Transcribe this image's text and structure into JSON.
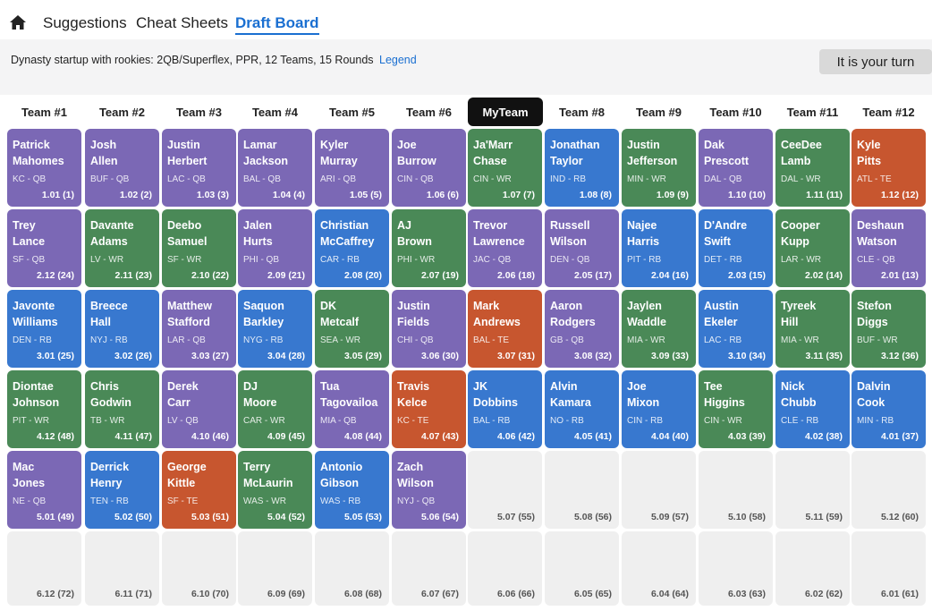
{
  "nav": {
    "tabs": [
      {
        "label": "Suggestions"
      },
      {
        "label": "Cheat Sheets"
      },
      {
        "label": "Draft Board"
      }
    ]
  },
  "header": {
    "description": "Dynasty startup with rookies: 2QB/Superflex, PPR, 12 Teams, 15 Rounds",
    "legend_link": "Legend",
    "turn_button": "It is your turn"
  },
  "colors": {
    "QB": "#7b68b5",
    "RB": "#3878cf",
    "WR": "#4a8957",
    "TE": "#c7562f",
    "active_tab": "#1a6fd1"
  },
  "teams": [
    "Team #1",
    "Team #2",
    "Team #3",
    "Team #4",
    "Team #5",
    "Team #6",
    "MyTeam",
    "Team #8",
    "Team #9",
    "Team #10",
    "Team #11",
    "Team #12"
  ],
  "rounds": [
    [
      {
        "first": "Patrick",
        "last": "Mahomes",
        "meta": "KC - QB",
        "pick": "1.01 (1)",
        "pos": "QB"
      },
      {
        "first": "Josh",
        "last": "Allen",
        "meta": "BUF - QB",
        "pick": "1.02 (2)",
        "pos": "QB"
      },
      {
        "first": "Justin",
        "last": "Herbert",
        "meta": "LAC - QB",
        "pick": "1.03 (3)",
        "pos": "QB"
      },
      {
        "first": "Lamar",
        "last": "Jackson",
        "meta": "BAL - QB",
        "pick": "1.04 (4)",
        "pos": "QB"
      },
      {
        "first": "Kyler",
        "last": "Murray",
        "meta": "ARI - QB",
        "pick": "1.05 (5)",
        "pos": "QB"
      },
      {
        "first": "Joe",
        "last": "Burrow",
        "meta": "CIN - QB",
        "pick": "1.06 (6)",
        "pos": "QB"
      },
      {
        "first": "Ja'Marr",
        "last": "Chase",
        "meta": "CIN - WR",
        "pick": "1.07 (7)",
        "pos": "WR"
      },
      {
        "first": "Jonathan",
        "last": "Taylor",
        "meta": "IND - RB",
        "pick": "1.08 (8)",
        "pos": "RB"
      },
      {
        "first": "Justin",
        "last": "Jefferson",
        "meta": "MIN - WR",
        "pick": "1.09 (9)",
        "pos": "WR"
      },
      {
        "first": "Dak",
        "last": "Prescott",
        "meta": "DAL - QB",
        "pick": "1.10 (10)",
        "pos": "QB"
      },
      {
        "first": "CeeDee",
        "last": "Lamb",
        "meta": "DAL - WR",
        "pick": "1.11 (11)",
        "pos": "WR"
      },
      {
        "first": "Kyle",
        "last": "Pitts",
        "meta": "ATL - TE",
        "pick": "1.12 (12)",
        "pos": "TE"
      }
    ],
    [
      {
        "first": "Trey",
        "last": "Lance",
        "meta": "SF - QB",
        "pick": "2.12 (24)",
        "pos": "QB"
      },
      {
        "first": "Davante",
        "last": "Adams",
        "meta": "LV - WR",
        "pick": "2.11 (23)",
        "pos": "WR"
      },
      {
        "first": "Deebo",
        "last": "Samuel",
        "meta": "SF - WR",
        "pick": "2.10 (22)",
        "pos": "WR"
      },
      {
        "first": "Jalen",
        "last": "Hurts",
        "meta": "PHI - QB",
        "pick": "2.09 (21)",
        "pos": "QB"
      },
      {
        "first": "Christian",
        "last": "McCaffrey",
        "meta": "CAR - RB",
        "pick": "2.08 (20)",
        "pos": "RB"
      },
      {
        "first": "AJ",
        "last": "Brown",
        "meta": "PHI - WR",
        "pick": "2.07 (19)",
        "pos": "WR"
      },
      {
        "first": "Trevor",
        "last": "Lawrence",
        "meta": "JAC - QB",
        "pick": "2.06 (18)",
        "pos": "QB"
      },
      {
        "first": "Russell",
        "last": "Wilson",
        "meta": "DEN - QB",
        "pick": "2.05 (17)",
        "pos": "QB"
      },
      {
        "first": "Najee",
        "last": "Harris",
        "meta": "PIT - RB",
        "pick": "2.04 (16)",
        "pos": "RB"
      },
      {
        "first": "D'Andre",
        "last": "Swift",
        "meta": "DET - RB",
        "pick": "2.03 (15)",
        "pos": "RB"
      },
      {
        "first": "Cooper",
        "last": "Kupp",
        "meta": "LAR - WR",
        "pick": "2.02 (14)",
        "pos": "WR"
      },
      {
        "first": "Deshaun",
        "last": "Watson",
        "meta": "CLE - QB",
        "pick": "2.01 (13)",
        "pos": "QB"
      }
    ],
    [
      {
        "first": "Javonte",
        "last": "Williams",
        "meta": "DEN - RB",
        "pick": "3.01 (25)",
        "pos": "RB"
      },
      {
        "first": "Breece",
        "last": "Hall",
        "meta": "NYJ - RB",
        "pick": "3.02 (26)",
        "pos": "RB"
      },
      {
        "first": "Matthew",
        "last": "Stafford",
        "meta": "LAR - QB",
        "pick": "3.03 (27)",
        "pos": "QB"
      },
      {
        "first": "Saquon",
        "last": "Barkley",
        "meta": "NYG - RB",
        "pick": "3.04 (28)",
        "pos": "RB"
      },
      {
        "first": "DK",
        "last": "Metcalf",
        "meta": "SEA - WR",
        "pick": "3.05 (29)",
        "pos": "WR"
      },
      {
        "first": "Justin",
        "last": "Fields",
        "meta": "CHI - QB",
        "pick": "3.06 (30)",
        "pos": "QB"
      },
      {
        "first": "Mark",
        "last": "Andrews",
        "meta": "BAL - TE",
        "pick": "3.07 (31)",
        "pos": "TE"
      },
      {
        "first": "Aaron",
        "last": "Rodgers",
        "meta": "GB - QB",
        "pick": "3.08 (32)",
        "pos": "QB"
      },
      {
        "first": "Jaylen",
        "last": "Waddle",
        "meta": "MIA - WR",
        "pick": "3.09 (33)",
        "pos": "WR"
      },
      {
        "first": "Austin",
        "last": "Ekeler",
        "meta": "LAC - RB",
        "pick": "3.10 (34)",
        "pos": "RB"
      },
      {
        "first": "Tyreek",
        "last": "Hill",
        "meta": "MIA - WR",
        "pick": "3.11 (35)",
        "pos": "WR"
      },
      {
        "first": "Stefon",
        "last": "Diggs",
        "meta": "BUF - WR",
        "pick": "3.12 (36)",
        "pos": "WR"
      }
    ],
    [
      {
        "first": "Diontae",
        "last": "Johnson",
        "meta": "PIT - WR",
        "pick": "4.12 (48)",
        "pos": "WR"
      },
      {
        "first": "Chris",
        "last": "Godwin",
        "meta": "TB - WR",
        "pick": "4.11 (47)",
        "pos": "WR"
      },
      {
        "first": "Derek",
        "last": "Carr",
        "meta": "LV - QB",
        "pick": "4.10 (46)",
        "pos": "QB"
      },
      {
        "first": "DJ",
        "last": "Moore",
        "meta": "CAR - WR",
        "pick": "4.09 (45)",
        "pos": "WR"
      },
      {
        "first": "Tua",
        "last": "Tagovailoa",
        "meta": "MIA - QB",
        "pick": "4.08 (44)",
        "pos": "QB"
      },
      {
        "first": "Travis",
        "last": "Kelce",
        "meta": "KC - TE",
        "pick": "4.07 (43)",
        "pos": "TE"
      },
      {
        "first": "JK",
        "last": "Dobbins",
        "meta": "BAL - RB",
        "pick": "4.06 (42)",
        "pos": "RB"
      },
      {
        "first": "Alvin",
        "last": "Kamara",
        "meta": "NO - RB",
        "pick": "4.05 (41)",
        "pos": "RB"
      },
      {
        "first": "Joe",
        "last": "Mixon",
        "meta": "CIN - RB",
        "pick": "4.04 (40)",
        "pos": "RB"
      },
      {
        "first": "Tee",
        "last": "Higgins",
        "meta": "CIN - WR",
        "pick": "4.03 (39)",
        "pos": "WR"
      },
      {
        "first": "Nick",
        "last": "Chubb",
        "meta": "CLE - RB",
        "pick": "4.02 (38)",
        "pos": "RB"
      },
      {
        "first": "Dalvin",
        "last": "Cook",
        "meta": "MIN - RB",
        "pick": "4.01 (37)",
        "pos": "RB"
      }
    ],
    [
      {
        "first": "Mac",
        "last": "Jones",
        "meta": "NE - QB",
        "pick": "5.01 (49)",
        "pos": "QB"
      },
      {
        "first": "Derrick",
        "last": "Henry",
        "meta": "TEN - RB",
        "pick": "5.02 (50)",
        "pos": "RB"
      },
      {
        "first": "George",
        "last": "Kittle",
        "meta": "SF - TE",
        "pick": "5.03 (51)",
        "pos": "TE"
      },
      {
        "first": "Terry",
        "last": "McLaurin",
        "meta": "WAS - WR",
        "pick": "5.04 (52)",
        "pos": "WR"
      },
      {
        "first": "Antonio",
        "last": "Gibson",
        "meta": "WAS - RB",
        "pick": "5.05 (53)",
        "pos": "RB"
      },
      {
        "first": "Zach",
        "last": "Wilson",
        "meta": "NYJ - QB",
        "pick": "5.06 (54)",
        "pos": "QB"
      },
      {
        "pick": "5.07 (55)",
        "pos": ""
      },
      {
        "pick": "5.08 (56)",
        "pos": ""
      },
      {
        "pick": "5.09 (57)",
        "pos": ""
      },
      {
        "pick": "5.10 (58)",
        "pos": ""
      },
      {
        "pick": "5.11 (59)",
        "pos": ""
      },
      {
        "pick": "5.12 (60)",
        "pos": ""
      }
    ],
    [
      {
        "pick": "6.12 (72)",
        "pos": ""
      },
      {
        "pick": "6.11 (71)",
        "pos": ""
      },
      {
        "pick": "6.10 (70)",
        "pos": ""
      },
      {
        "pick": "6.09 (69)",
        "pos": ""
      },
      {
        "pick": "6.08 (68)",
        "pos": ""
      },
      {
        "pick": "6.07 (67)",
        "pos": ""
      },
      {
        "pick": "6.06 (66)",
        "pos": ""
      },
      {
        "pick": "6.05 (65)",
        "pos": ""
      },
      {
        "pick": "6.04 (64)",
        "pos": ""
      },
      {
        "pick": "6.03 (63)",
        "pos": ""
      },
      {
        "pick": "6.02 (62)",
        "pos": ""
      },
      {
        "pick": "6.01 (61)",
        "pos": ""
      }
    ]
  ]
}
